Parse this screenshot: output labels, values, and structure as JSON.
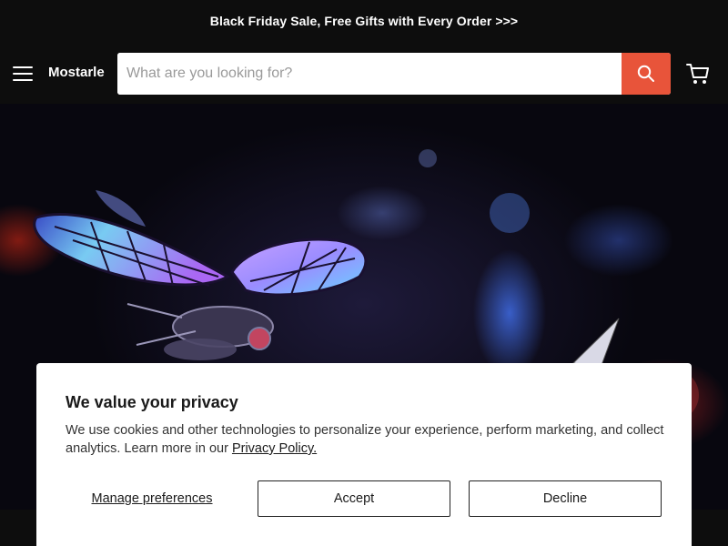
{
  "announcement": {
    "text": "Black Friday Sale, Free Gifts with Every Order >>>"
  },
  "header": {
    "menu_icon": "hamburger-menu-icon",
    "logo_text": "Mostarle",
    "search": {
      "placeholder": "What are you looking for?",
      "value": "",
      "button_icon": "search-icon"
    },
    "cart_icon": "cart-icon"
  },
  "hero": {
    "image": "illuminated-mechanical-dragonfly-model"
  },
  "cookie_banner": {
    "title": "We value your privacy",
    "body_text": "We use cookies and other technologies to personalize your experience, perform marketing, and collect analytics. Learn more in our ",
    "policy_link": "Privacy Policy.",
    "manage_label": "Manage preferences",
    "accept_label": "Accept",
    "decline_label": "Decline"
  },
  "colors": {
    "header_bg": "#0d0d0d",
    "accent": "#e8543a",
    "banner_bg": "#ffffff"
  }
}
